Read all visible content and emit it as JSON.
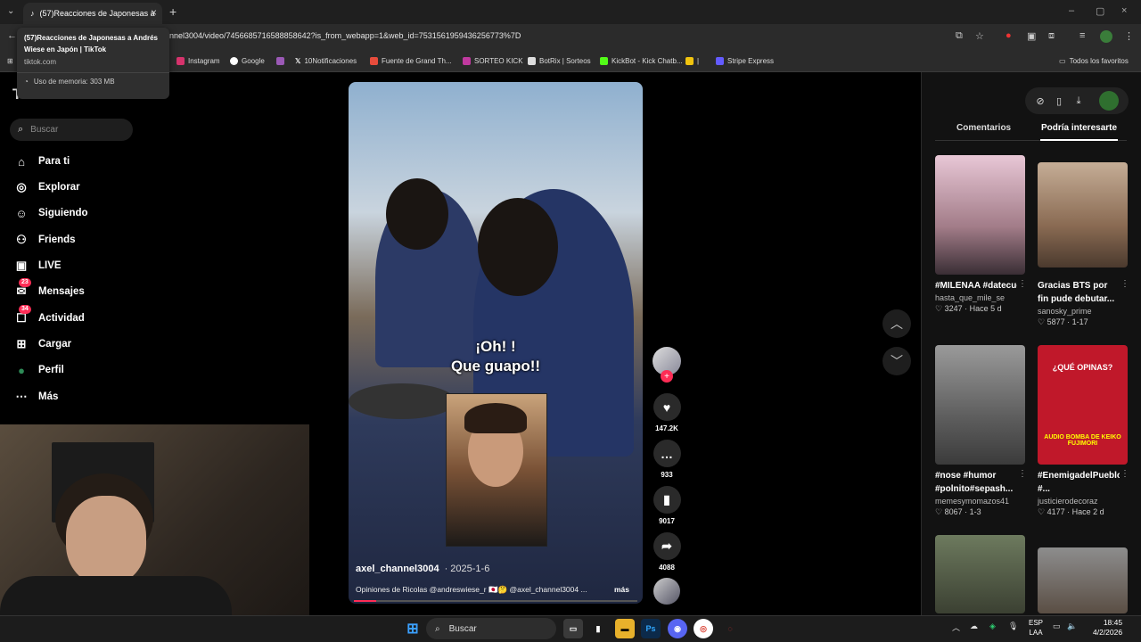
{
  "browser": {
    "tab_title": "(57)Reacciones de Japonesas a",
    "new_tab": "+",
    "url": "nnel3004/video/7456685716588858642?is_from_webapp=1&web_id=7531561959436256773%7D",
    "bookmarks": [
      "Instagram",
      "Google",
      "10Notificaciones",
      "Fuente de Grand Th...",
      "SORTEO KICK",
      "BotRix | Sorteos",
      "KickBot - Kick Chatb...",
      "|",
      "Stripe Express"
    ],
    "all_bookmarks": "Todos los favoritos",
    "tooltip": {
      "title": "(57)Reacciones de Japonesas a Andrés Wiese en Japón | TikTok",
      "domain": "tiktok.com",
      "memory": "Uso de memoria: 303 MB"
    }
  },
  "sidebar": {
    "logo": "TikTok",
    "search_placeholder": "Buscar",
    "items": [
      {
        "label": "Para ti",
        "icon": "home-icon"
      },
      {
        "label": "Explorar",
        "icon": "compass-icon"
      },
      {
        "label": "Siguiendo",
        "icon": "following-icon"
      },
      {
        "label": "Friends",
        "icon": "friends-icon"
      },
      {
        "label": "LIVE",
        "icon": "live-icon"
      },
      {
        "label": "Mensajes",
        "icon": "messages-icon",
        "badge": "23"
      },
      {
        "label": "Actividad",
        "icon": "activity-icon",
        "badge": "34"
      },
      {
        "label": "Cargar",
        "icon": "upload-icon"
      },
      {
        "label": "Perfil",
        "icon": "profile-icon"
      },
      {
        "label": "Más",
        "icon": "more-icon"
      }
    ]
  },
  "video": {
    "overlay_text_1": "¡Oh! !",
    "overlay_text_2": "Que guapo!!",
    "author": "axel_channel3004",
    "date": "· 2025-1-6",
    "description": "Opiniones de Ricolas @andreswiese_r 🇯🇵🤔 @axel_channel3004 ...",
    "more": "más",
    "likes": "147.2K",
    "comments": "933",
    "saves": "9017",
    "shares": "4088"
  },
  "right_panel": {
    "tabs": [
      "Comentarios",
      "Podría interesarte"
    ],
    "cards": [
      {
        "title": "#MILENAA #datecuenta...",
        "user": "hasta_que_mile_se",
        "likes": "3247",
        "age": "Hace 5 d"
      },
      {
        "title": "Gracias BTS por fin pude debutar...",
        "user": "sanosky_prime",
        "likes": "5877",
        "age": "1-17"
      },
      {
        "title": "#nose #humor #polnito#sepash...",
        "user": "memesymomazos41",
        "likes": "8067",
        "age": "1-3"
      },
      {
        "title": "#EnemigadelPueblo #...",
        "user": "justicierodecoraz",
        "likes": "4177",
        "age": "Hace 2 d"
      }
    ],
    "thumb_text_4a": "¿QUÉ OPINAS?",
    "thumb_text_4b": "AUDIO BOMBA DE KEIKO FUJIMORI"
  },
  "taskbar": {
    "search": "Buscar",
    "lang": "ESP",
    "region": "LAA",
    "time": "18:45",
    "date": "4/2/2026"
  }
}
